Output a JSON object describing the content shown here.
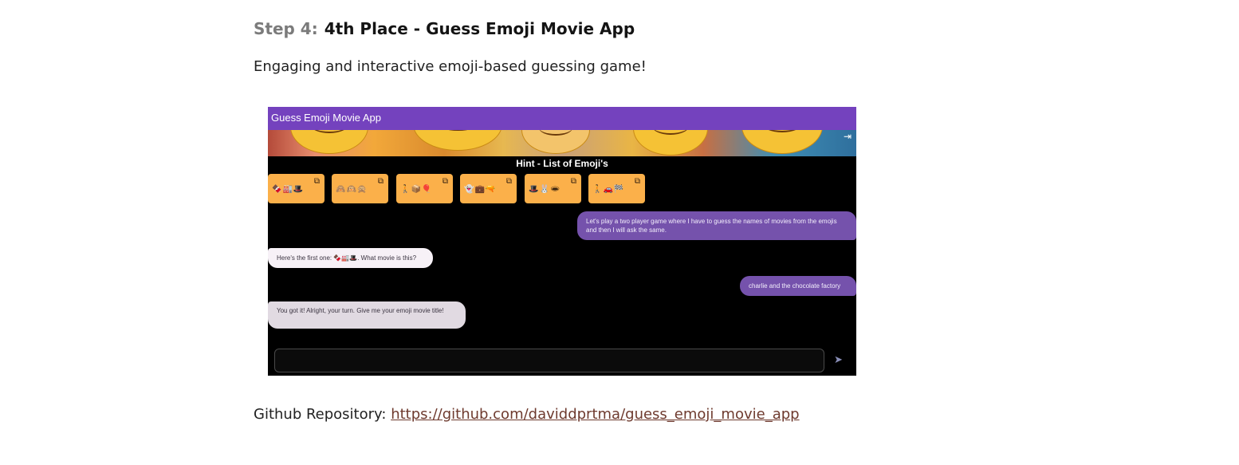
{
  "step": {
    "prefix": "Step 4:",
    "title": "4th Place - Guess Emoji Movie App"
  },
  "description": "Engaging and interactive emoji-based guessing game!",
  "app": {
    "title": "Guess Emoji Movie App",
    "logout_icon": "logout-icon",
    "hint_title": "Hint - List of Emoji's",
    "hint_cards": [
      {
        "emojis": "🍫🏭🎩",
        "icon": "copy-icon"
      },
      {
        "emojis": "🙈🙉🙊",
        "icon": "copy-icon"
      },
      {
        "emojis": "🚶📦🎈",
        "icon": "copy-icon"
      },
      {
        "emojis": "👻💼🔫",
        "icon": "copy-icon"
      },
      {
        "emojis": "🎩🐰🕳",
        "icon": "copy-icon"
      },
      {
        "emojis": "🚶🚗🏁",
        "icon": "copy-icon"
      }
    ],
    "messages": [
      {
        "role": "user",
        "text": "Let's play a two player game where I have to guess the names of movies from the emojis and then I will ask the same."
      },
      {
        "role": "bot",
        "text": "Here's the first one: 🍫🏭🎩. What movie is this?"
      },
      {
        "role": "user",
        "text": "charlie and the chocolate factory"
      },
      {
        "role": "bot",
        "text": "You got it! Alright, your turn. Give me your emoji movie title!"
      }
    ],
    "input_placeholder": "",
    "send_icon": "send-icon"
  },
  "repo": {
    "label": "Github Repository:",
    "url": "https://github.com/daviddprtma/guess_emoji_movie_app"
  }
}
